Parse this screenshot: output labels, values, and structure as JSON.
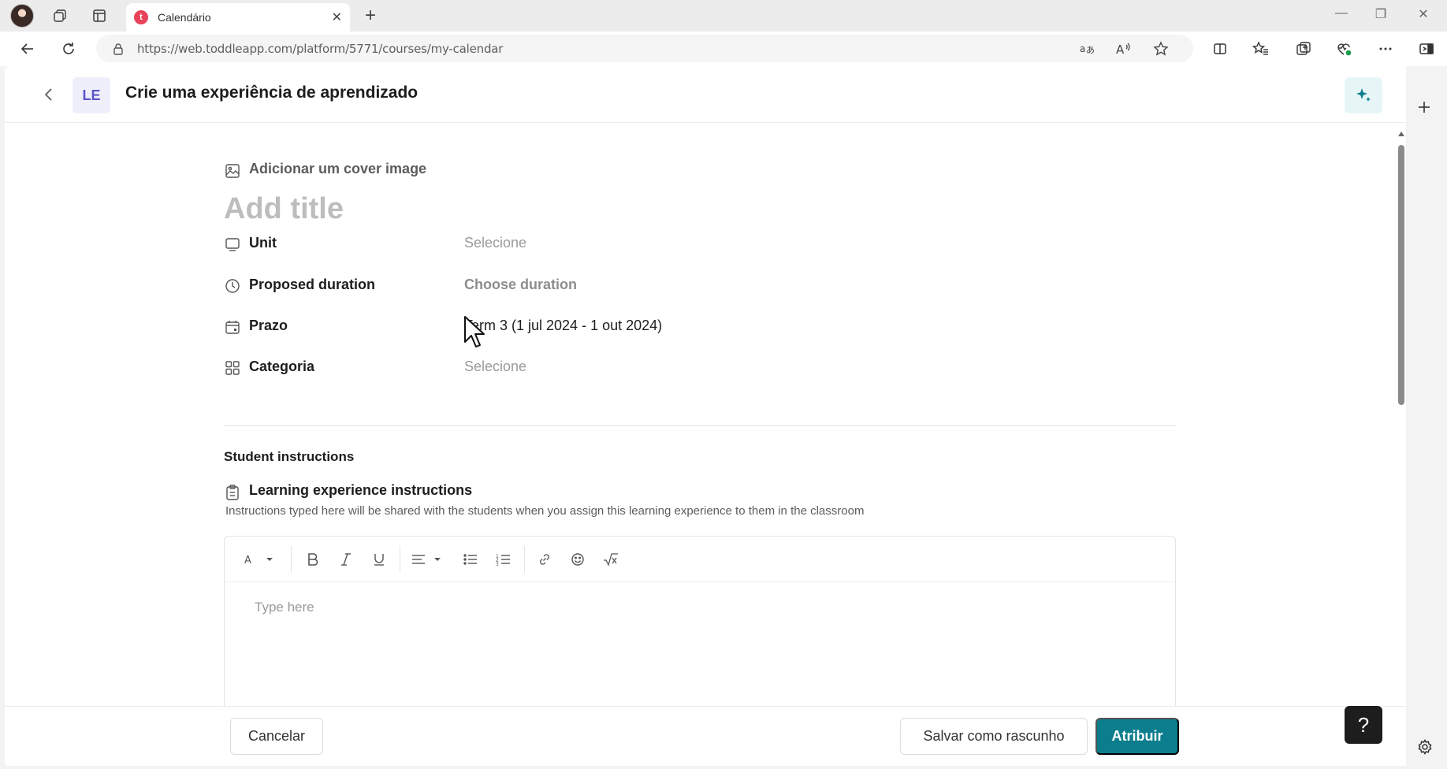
{
  "browser": {
    "tab_title": "Calendário",
    "tab_favicon": "t",
    "new_tab": "+",
    "url": "https://web.toddleapp.com/platform/5771/courses/my-calendar",
    "window_controls": {
      "minimize": "—",
      "restore": "❐",
      "close": "✕"
    },
    "tab_close": "✕"
  },
  "header": {
    "badge": "LE",
    "title": "Crie uma experiência de aprendizado"
  },
  "form": {
    "cover_label": "Adicionar um cover image",
    "title_placeholder": "Add title",
    "fields": [
      {
        "label": "Unit",
        "value": "Selecione",
        "icon": "monitor-icon"
      },
      {
        "label": "Proposed duration",
        "value": "Choose duration",
        "icon": "clock-icon"
      },
      {
        "label": "Prazo",
        "value": "Term 3 (1 jul 2024 - 1 out 2024)",
        "icon": "calendar-icon"
      },
      {
        "label": "Categoria",
        "value": "Selecione",
        "icon": "grid-icon"
      }
    ]
  },
  "instructions": {
    "section_title": "Student instructions",
    "title": "Learning experience instructions",
    "description": "Instructions typed here will be shared with the students when you assign this learning experience to them in the classroom",
    "editor_placeholder": "Type here"
  },
  "footer": {
    "cancel": "Cancelar",
    "save_draft": "Salvar como rascunho",
    "assign": "Atribuir",
    "help": "?"
  },
  "colors": {
    "primary": "#0c7d8c",
    "badge_bg": "#efeffb",
    "badge_text": "#5b55c9",
    "ai_bg": "#e6f6f7"
  }
}
